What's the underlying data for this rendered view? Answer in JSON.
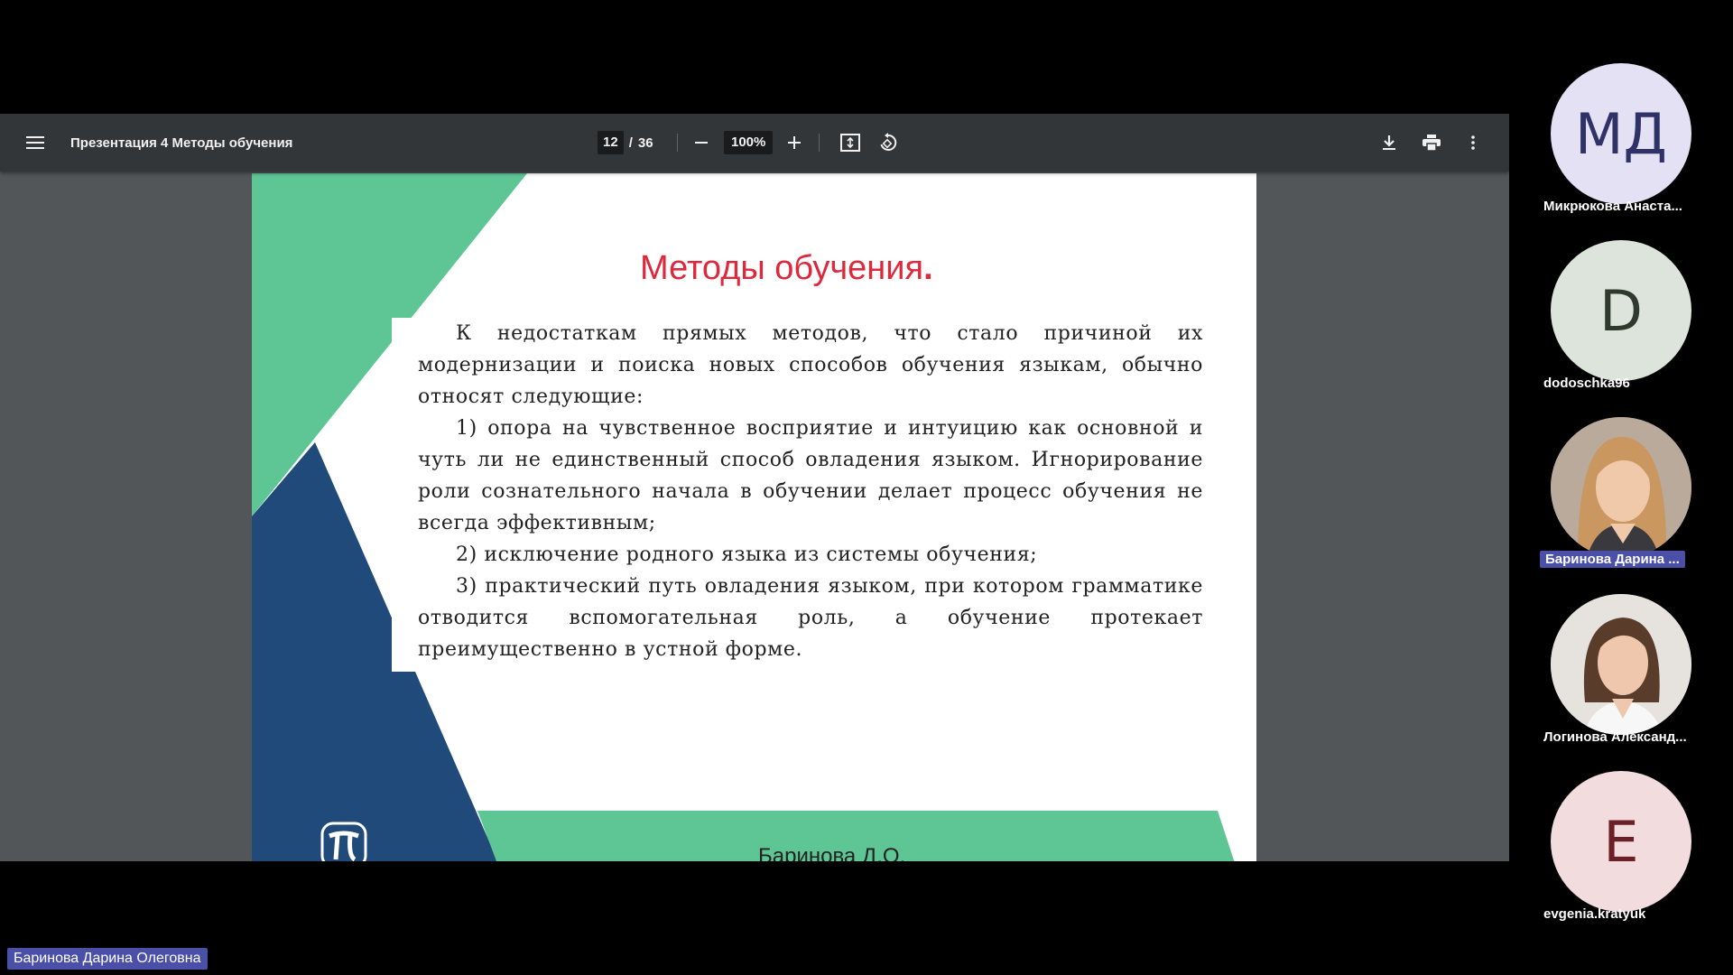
{
  "viewer": {
    "title": "Презентация 4 Методы обучения",
    "page_current": "12",
    "page_sep": "/",
    "page_total": "36",
    "zoom": "100%"
  },
  "slide": {
    "title": "Методы обучения",
    "title_dot": ".",
    "paragraphs": [
      "К недостаткам прямых методов, что стало причиной их модернизации и поиска новых способов обучения языкам, обычно относят следующие:",
      "1) опора на чувственное восприятие и интуицию как основной и чуть ли не единственный способ овладения языком. Игнорирование роли сознательного начала в обучении делает процесс обучения не всегда эффективным;",
      "2) исключение родного языка из системы обучения;",
      "3) практический путь овладения языком, при котором грамматике отводится вспомогательная роль, а обучение протекает преимущественно в устной форме."
    ],
    "author": "Баринова Д.О.",
    "colors": {
      "green": "#5ec595",
      "navy": "#1f4a7a",
      "title": "#e0283c"
    }
  },
  "participants": [
    {
      "initials": "МД",
      "name": "Микрюкова Анаста...",
      "bg": "#e3e1f3",
      "fg": "#2f3266"
    },
    {
      "initials": "D",
      "name": "dodoschka96",
      "bg": "#dde4dc",
      "fg": "#2f3a2e"
    },
    {
      "initials": "",
      "name": "Баринова Дарина ...",
      "bg": "#c9a27d",
      "fg": "#ffffff",
      "photo": true
    },
    {
      "initials": "",
      "name": "Логинова Александ...",
      "bg": "#d9d6d2",
      "fg": "#ffffff",
      "photo": true
    },
    {
      "initials": "E",
      "name": "evgenia.kratyuk",
      "bg": "#f3dcde",
      "fg": "#6b1f26"
    }
  ],
  "presenter": "Баринова Дарина Олеговна"
}
